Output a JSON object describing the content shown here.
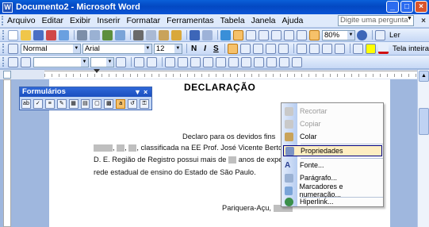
{
  "window": {
    "title": "Documento2 - Microsoft Word",
    "app_icon": "W"
  },
  "menu": {
    "items": [
      "Arquivo",
      "Editar",
      "Exibir",
      "Inserir",
      "Formatar",
      "Ferramentas",
      "Tabela",
      "Janela",
      "Ajuda"
    ],
    "question_placeholder": "Digite uma pergunta"
  },
  "toolbar_standard": {
    "zoom": "80%",
    "read_label": "Ler"
  },
  "toolbar_format": {
    "style": "Normal",
    "font": "Arial",
    "size": "12",
    "bold": "N",
    "italic": "I",
    "underline": "S",
    "fullscreen_label": "Tela inteira"
  },
  "form_toolbar": {
    "title": "Formulários"
  },
  "document": {
    "title": "DECLARAÇÃO",
    "line1": "Declaro para os devidos fins",
    "line2": "classificada na EE Prof. José Vicente Bertoli,",
    "line3_a": "D. E. Região de Registro possui mais de",
    "line3_b": "anos de exper",
    "line4": "rede estadual de ensino do Estado de São Paulo.",
    "line5": "Pariquera-Açu,"
  },
  "context_menu": {
    "items": [
      {
        "label": "Recortar",
        "disabled": true,
        "icon": "scissors-icon"
      },
      {
        "label": "Copiar",
        "disabled": true,
        "icon": "copy-icon"
      },
      {
        "label": "Colar",
        "disabled": false,
        "icon": "paste-icon"
      },
      {
        "label": "Propriedades",
        "disabled": false,
        "icon": "properties-icon",
        "highlighted": true
      },
      {
        "label": "Fonte...",
        "disabled": false,
        "icon": "font-icon"
      },
      {
        "label": "Parágrafo...",
        "disabled": false,
        "icon": "paragraph-icon"
      },
      {
        "label": "Marcadores e numeração...",
        "disabled": false,
        "icon": "bullets-icon"
      },
      {
        "label": "Hiperlink...",
        "disabled": false,
        "icon": "hyperlink-icon"
      }
    ]
  },
  "colors": {
    "title_bar": "#0348c2",
    "highlight": "#ffeec2",
    "accent_orange": "#f6c16a"
  }
}
